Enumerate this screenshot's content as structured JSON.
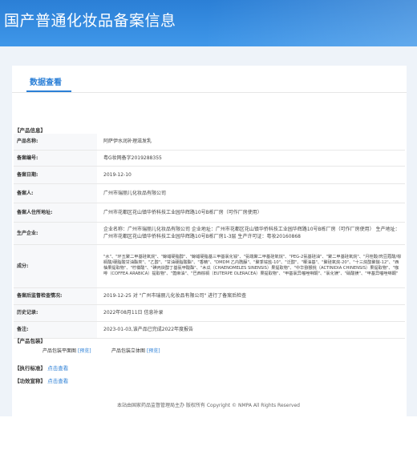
{
  "header": {
    "title": "国产普通化妆品备案信息"
  },
  "tabs": [
    {
      "label": "数据查看"
    }
  ],
  "product_section": {
    "label": "【产品信息】"
  },
  "rows": [
    {
      "key": "产品名称:",
      "value": "阿萨伊水润补理滋发乳"
    },
    {
      "key": "备案编号:",
      "value": "粤G妆网备字2019288355"
    },
    {
      "key": "备案日期:",
      "value": "2019-12-10"
    },
    {
      "key": "备案人:",
      "value": "广州市瑞丽儿化妆品有限公司"
    },
    {
      "key": "备案人住所地址:",
      "value": "广州市花都区花山镇华侨科技工业园华辉路10号B栋厂房（可作厂房使用）"
    },
    {
      "key": "生产企业:",
      "value": "企业名称：广州市瑞丽儿化妆品有限公司 企业地址：广州市花都区花山镇华侨科技工业园华辉路10号B栋厂房（可作厂房使用） 生产地址：广州市花都区花山镇华侨科技工业园华辉路10号B栋厂房1-3层 生产许可证：粤妆20160868"
    },
    {
      "key": "成分:",
      "value": "\"水\"、\"环五聚二甲基硅氧烷\"、\"鲸蜡硬脂醇\"、\"鲸蜡硬脂基三甲基氯化铵\"、\"氨端聚二甲基硅氧烷\"、\"PEG-2氨基硅油\"、\"聚二甲基硅氧烷\"、\"月桂酸/肉豆蔻酸/棕榈酸/硬脂酸甘油酯类\"、\"乙醇\"、\"甘油硬脂酸酯\"、\"香精\"、\"DMDM 乙内酰脲\"、\"聚季铵盐-10\"、\"泛醇\"、\"椰油基\"、\"聚硅氧烷-20\"、\"十三烷醇聚醚-12\"、\"西柚果提取物\"、\"柠檬酸\"、\"碘丙炔醇丁基氨甲酸酯\"、\"木瓜（CHAENOMELES SINENSIS）果提取物\"、\"中华猕猴桃（ACTINIDIA CHINENSIS）果提取物\"、\"咖啡（COFFEA ARABICA）提取物\"、\"蓖麻油\"、\"巴西棕榈（EUTERPE OLERACEA）果提取物\"、\"甲基氯异噻唑啉酮\"、\"氯化镁\"、\"硝酸镁\"、\"甲基异噻唑啉酮\""
    },
    {
      "key": "备案后监督检查情况:",
      "value": "2019-12-25 对 \"广州市瑞丽儿化妆品有限公司\" 进行了备案后检查"
    },
    {
      "key": "历史记录:",
      "value": "2022年08月11日 信息补录"
    },
    {
      "key": "备注:",
      "value": "2023-01-03,该产品已完成2022年度报告"
    }
  ],
  "package_section": {
    "label": "【产品包装】",
    "front_label": "产品包装平面图",
    "front_link": "[预览]",
    "stereo_label": "产品包装立体图",
    "stereo_link": "[预览]"
  },
  "standard_section": {
    "label": "【执行标准】",
    "link": "点击查看"
  },
  "efficacy_section": {
    "label": "【功效宣称】",
    "link": "点击查看"
  },
  "footer": {
    "text": "本站由国家药品监督管理局主办 版权所有 Copyright © NMPA All Rights Reserved"
  },
  "colors": {
    "banner": "#2b7fd6",
    "accent": "#2b7fd6",
    "background": "#eef3f9"
  }
}
